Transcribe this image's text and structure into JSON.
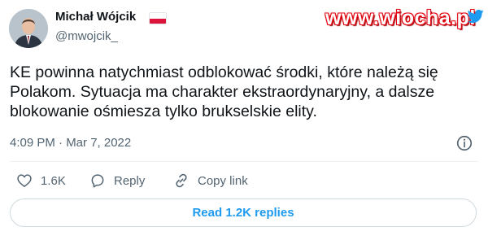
{
  "author": {
    "name": "Michał Wójcik",
    "handle": "@mwojcik_"
  },
  "watermark": "www.wiocha.pl",
  "tweet": {
    "text": "KE powinna natychmiast odblokować środki, które należą się Polakom. Sytuacja ma charakter ekstraordynaryjny, a dalsze blokowanie ośmiesza tylko brukselskie elity.",
    "timestamp": "4:09 PM · Mar 7, 2022"
  },
  "actions": {
    "likes": "1.6K",
    "reply_label": "Reply",
    "copy_link_label": "Copy link"
  },
  "read_replies_label": "Read 1.2K replies",
  "icons": {
    "flag": "poland-flag-icon",
    "info": "info-icon",
    "like": "heart-icon",
    "reply": "reply-icon",
    "copy_link": "link-icon",
    "brand": "twitter-bird-icon"
  },
  "colors": {
    "accent": "#1d9bf0",
    "secondary_text": "#536471",
    "watermark": "#e30613"
  }
}
